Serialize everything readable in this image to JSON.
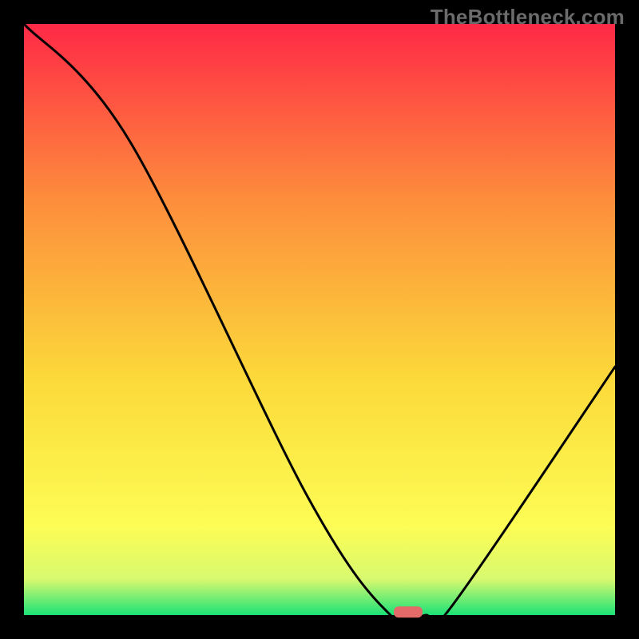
{
  "watermark": "TheBottleneck.com",
  "chart_data": {
    "type": "line",
    "title": "",
    "xlabel": "",
    "ylabel": "",
    "xlim": [
      0,
      100
    ],
    "ylim": [
      0,
      100
    ],
    "x": [
      0,
      18,
      48,
      62,
      68,
      72,
      100
    ],
    "values": [
      100,
      80,
      20,
      0,
      0,
      1,
      42
    ],
    "notes": "Curve starts at top-left, descends with a slight knee near x≈18, bottoms out flat around x≈62–68, then rises to ≈42 at right edge. Values are estimated from the plot; no axis tick labels are shown.",
    "background_gradient": {
      "top": "#fe2946",
      "upper_mid": "#fd8e3c",
      "mid": "#fcd93a",
      "lower_mid": "#fdfd55",
      "band": "#d7f96f",
      "bottom": "#1be277"
    },
    "marker": {
      "x": 65,
      "y": 0.5,
      "color": "#e46a6a",
      "shape": "rounded-bar"
    },
    "plot_border_color": "#000000"
  }
}
